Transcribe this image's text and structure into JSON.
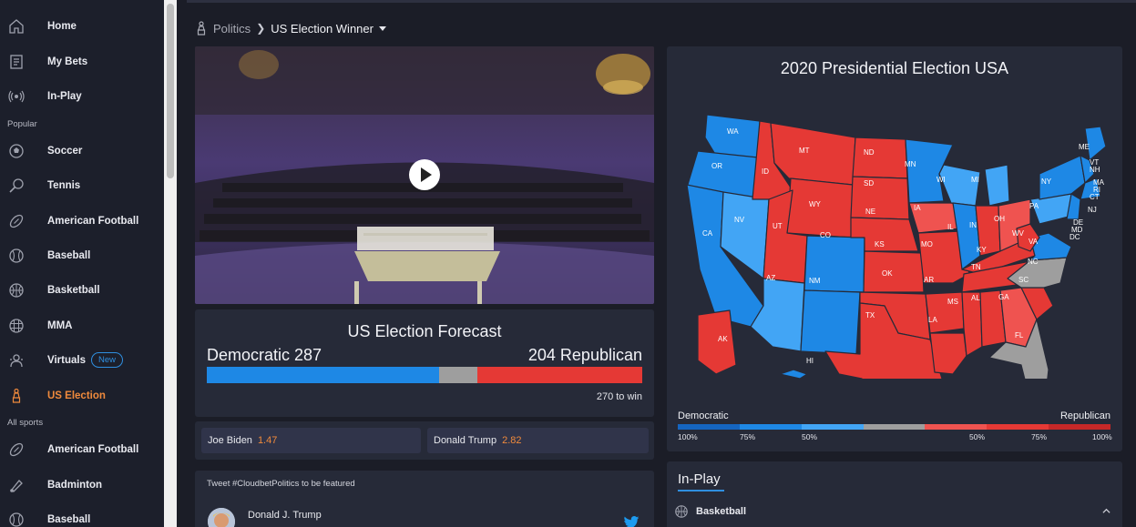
{
  "sidebar": {
    "items": [
      {
        "label": "Home",
        "icon": "home-icon"
      },
      {
        "label": "My Bets",
        "icon": "betslip-icon"
      },
      {
        "label": "In-Play",
        "icon": "broadcast-icon"
      }
    ],
    "popular_label": "Popular",
    "popular": [
      {
        "label": "Soccer",
        "icon": "soccer-ball-icon"
      },
      {
        "label": "Tennis",
        "icon": "tennis-racket-icon"
      },
      {
        "label": "American Football",
        "icon": "american-football-icon"
      },
      {
        "label": "Baseball",
        "icon": "baseball-icon"
      },
      {
        "label": "Basketball",
        "icon": "basketball-icon"
      },
      {
        "label": "MMA",
        "icon": "mma-glove-icon"
      },
      {
        "label": "Virtuals",
        "icon": "virtuals-icon",
        "badge": "New"
      },
      {
        "label": "US Election",
        "icon": "election-icon",
        "active": true
      }
    ],
    "all_sports_label": "All sports",
    "all_sports": [
      {
        "label": "American Football",
        "icon": "american-football-icon"
      },
      {
        "label": "Badminton",
        "icon": "badminton-icon"
      },
      {
        "label": "Baseball",
        "icon": "baseball-icon"
      }
    ]
  },
  "breadcrumb": {
    "parent": "Politics",
    "current": "US Election Winner"
  },
  "forecast": {
    "title": "US Election Forecast",
    "democratic_label": "Democratic 287",
    "republican_label": "204 Republican",
    "democratic_seats": 287,
    "undecided_seats": 47,
    "republican_seats": 204,
    "to_win": "270 to win"
  },
  "odds": [
    {
      "name": "Joe Biden",
      "value": "1.47"
    },
    {
      "name": "Donald Trump",
      "value": "2.82"
    }
  ],
  "tweets": {
    "header": "Tweet #CloudbetPolitics to be featured",
    "author": "Donald J. Trump"
  },
  "map": {
    "title": "2020 Presidential Election USA",
    "legend_left": "Democratic",
    "legend_right": "Republican",
    "legend_ticks": [
      "100%",
      "75%",
      "50%",
      "50%",
      "75%",
      "100%"
    ],
    "state_labels": [
      "WA",
      "OR",
      "CA",
      "NV",
      "ID",
      "MT",
      "WY",
      "UT",
      "AZ",
      "CO",
      "NM",
      "ND",
      "SD",
      "NE",
      "KS",
      "OK",
      "TX",
      "MN",
      "IA",
      "MO",
      "AR",
      "LA",
      "WI",
      "IL",
      "MI",
      "IN",
      "OH",
      "KY",
      "TN",
      "MS",
      "AL",
      "GA",
      "FL",
      "SC",
      "NC",
      "VA",
      "WV",
      "PA",
      "NY",
      "ME",
      "VT",
      "NH",
      "MA",
      "RI",
      "CT",
      "NJ",
      "DE",
      "MD",
      "DC",
      "AK",
      "HI"
    ]
  },
  "colors": {
    "dem_strong": "#1565c0",
    "dem": "#1e88e5",
    "dem_lean": "#42a5f5",
    "tossup": "#9e9e9e",
    "rep_lean": "#ef5350",
    "rep": "#e53935",
    "rep_strong": "#c62828",
    "accent_orange": "#f08a3c",
    "accent_blue": "#2f8fe0"
  },
  "inplay": {
    "title": "In-Play",
    "sport": "Basketball"
  }
}
